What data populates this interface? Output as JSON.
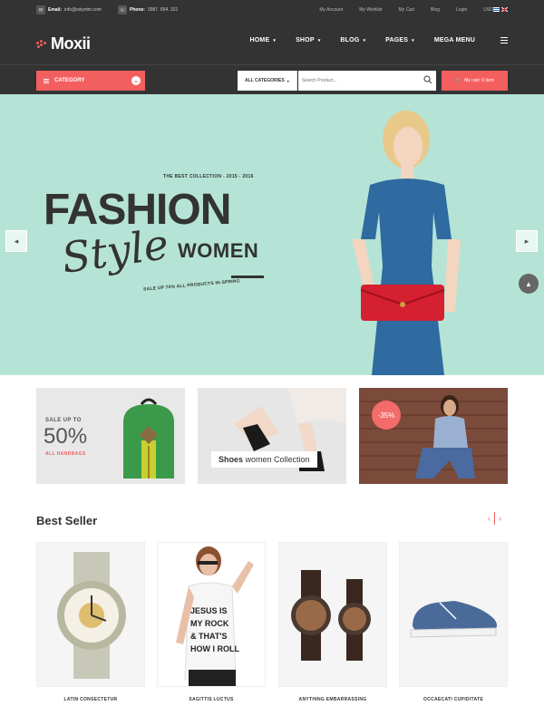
{
  "topbar": {
    "email_label": "Email:",
    "email_value": "info@ssiyntm.com",
    "phone_label": "Phone:",
    "phone_value": "0987. 654. 321",
    "links": [
      "My Account",
      "My Wishlist",
      "My Cart",
      "Blog",
      "Login",
      "USD $"
    ]
  },
  "header": {
    "brand": "Moxii",
    "nav": [
      {
        "label": "HOME"
      },
      {
        "label": "SHOP"
      },
      {
        "label": "BLOG"
      },
      {
        "label": "PAGES"
      },
      {
        "label": "MEGA MENU"
      }
    ]
  },
  "searchbar": {
    "category_label": "CATEGORY",
    "all_categories": "ALL CATEGORIES",
    "search_placeholder": "Search Product...",
    "cart_label": "My cart: 0 item"
  },
  "hero": {
    "kicker": "THE BEST COLLECTION - 2015 - 2016",
    "title": "FASHION",
    "script": "Style",
    "subtitle": "WOMEN",
    "sale": "SALE UP 70% ALL PRODUCTS IN SPRING"
  },
  "banners": {
    "b1_top": "SALE UP TO",
    "b1_pct": "50%",
    "b1_bottom": "ALL HANDBAGS",
    "b2_bold": "Shoes",
    "b2_rest": " women Collection",
    "b3_badge": "-35%"
  },
  "bestseller": {
    "title": "Best Seller",
    "products": [
      {
        "name": "LATIN CONSECTETUR"
      },
      {
        "name": "SAGITTIS LUCTUS"
      },
      {
        "name": "ANYTHING EMBARRASSING"
      },
      {
        "name": "OCCAECATI CUPIDITATE"
      }
    ]
  },
  "colors": {
    "accent": "#f35f5f",
    "dark": "#333333",
    "hero_bg": "#b5e4d6"
  },
  "icons": [
    "mail-icon",
    "phone-icon",
    "flag-icon",
    "hamburger-icon",
    "chevron-down-icon",
    "search-icon",
    "cart-icon",
    "arrow-left-icon",
    "arrow-right-icon",
    "arrow-up-icon"
  ]
}
